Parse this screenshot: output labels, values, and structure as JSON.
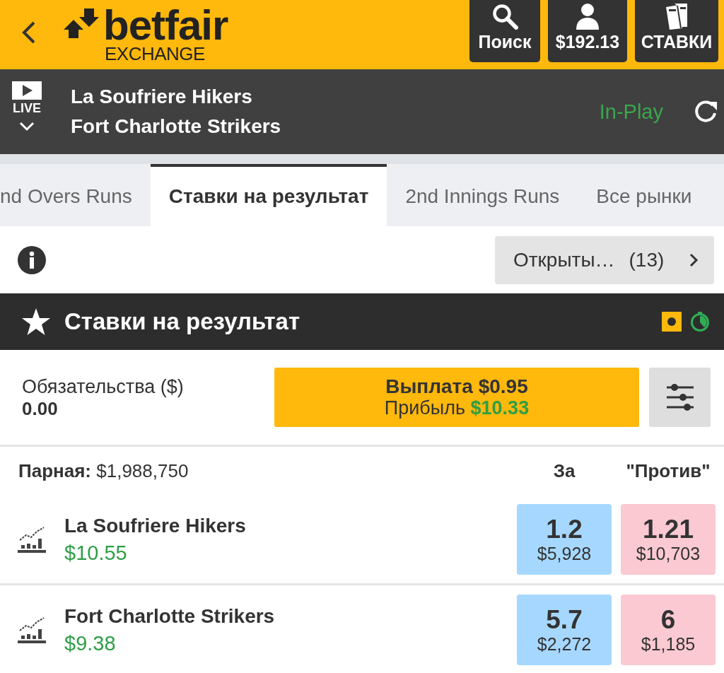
{
  "header": {
    "logo": {
      "name": "betfair",
      "subtitle": "EXCHANGE"
    },
    "actions": [
      {
        "kind": "search",
        "label": "Поиск"
      },
      {
        "kind": "account",
        "label": "$192.13"
      },
      {
        "kind": "bets",
        "label": "СТАВКИ"
      }
    ]
  },
  "event": {
    "live_label": "LIVE",
    "teams": [
      "La Soufriere Hikers",
      "Fort Charlotte Strikers"
    ],
    "status": "In-Play"
  },
  "tabs": [
    {
      "label": "nd Overs Runs",
      "selected": false
    },
    {
      "label": "Ставки на результат",
      "selected": true
    },
    {
      "label": "2nd Innings Runs",
      "selected": false
    },
    {
      "label": "Все рынки",
      "selected": false
    }
  ],
  "open_bets": {
    "label": "Открыты…",
    "count": "(13)"
  },
  "market": {
    "title": "Ставки на результат"
  },
  "liability": {
    "label": "Обязательства ($)",
    "value": "0.00"
  },
  "cash_out": {
    "title": "Выплата $0.95",
    "profit_label": "Прибыль",
    "profit_value": "$10.33"
  },
  "runners_header": {
    "matched": "**Парная:** $1,988,750",
    "back_label": "За",
    "lay_label": "\"Против\""
  },
  "runners": [
    {
      "name": "La Soufriere Hikers",
      "pnl": "$10.55",
      "back": {
        "price": "1.2",
        "size": "$5,928"
      },
      "lay": {
        "price": "1.21",
        "size": "$10,703"
      }
    },
    {
      "name": "Fort Charlotte Strikers",
      "pnl": "$9.38",
      "back": {
        "price": "5.7",
        "size": "$2,272"
      },
      "lay": {
        "price": "6",
        "size": "$1,185"
      }
    }
  ]
}
